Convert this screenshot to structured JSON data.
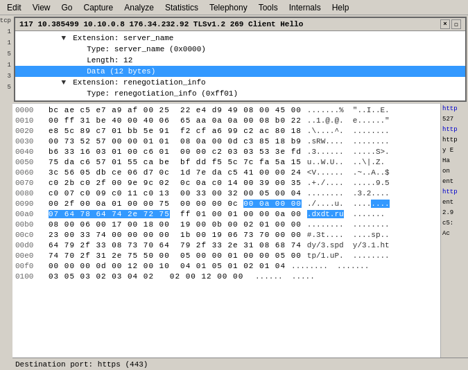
{
  "menu": {
    "items": [
      "Edit",
      "View",
      "Go",
      "Capture",
      "Analyze",
      "Statistics",
      "Telephony",
      "Tools",
      "Internals",
      "Help"
    ]
  },
  "panel": {
    "title": "117  10.385499  10.10.0.8  176.34.232.92  TLSv1.2  269  Client Hello",
    "close_label": "×",
    "resize_label": "◻"
  },
  "tree": {
    "rows": [
      {
        "indent": 60,
        "triangle": "",
        "text": "Extension: server_name",
        "selected": false
      },
      {
        "indent": 80,
        "triangle": "",
        "text": "Type: server_name (0x0000)",
        "selected": false
      },
      {
        "indent": 80,
        "triangle": "",
        "text": "Length: 12",
        "selected": false
      },
      {
        "indent": 80,
        "triangle": "",
        "text": "Data (12 bytes)",
        "selected": true
      },
      {
        "indent": 60,
        "triangle": "▼",
        "text": "Extension: renegotiation_info",
        "selected": false
      },
      {
        "indent": 80,
        "triangle": "",
        "text": "Type: renegotiation_info (0xff01)",
        "selected": false
      }
    ]
  },
  "hex": {
    "rows": [
      {
        "offset": "0000",
        "bytes": "bc ae c5 e7 a9 af 00 25  22 e4 d9 49 08 00 45 00",
        "ascii": ".......%  \"..I..E.",
        "highlight": null
      },
      {
        "offset": "0010",
        "bytes": "00 ff 31 be 40 00 40 06  65 aa 0a 0a 00 08 b0 22",
        "ascii": "..1.@.@.  e......\"",
        "highlight": null
      },
      {
        "offset": "0020",
        "bytes": "e8 5c 89 c7 01 bb 5e 91  f2 cf a6 99 c2 ac 80 18",
        "ascii": ".\\....^.  ........",
        "highlight": null
      },
      {
        "offset": "0030",
        "bytes": "00 73 52 57 00 00 01 01  08 0a 00 0d c3 85 18 b9",
        "ascii": ".sRW....  ........",
        "highlight": null
      },
      {
        "offset": "0040",
        "bytes": "b6 33 16 03 01 00 c6 01  00 00 c2 03 03 53 3e fd",
        "ascii": ".3.......  .....S>.",
        "highlight": null
      },
      {
        "offset": "0050",
        "bytes": "75 da c6 57 01 55 ca be  bf dd f5 5c 7c fa 5a 15",
        "ascii": "u..W.U..  ..\\|.Z.",
        "highlight": null
      },
      {
        "offset": "0060",
        "bytes": "3c 56 05 db ce 06 d7 0c  1d 7e da c5 41 00 00 24",
        "ascii": "<V......  .~..A..$",
        "highlight": null
      },
      {
        "offset": "0070",
        "bytes": "c0 2b c0 2f 00 9e 9c 02  0c 0a c0 14 00 39 00 35",
        "ascii": ".+./....  .....9.5",
        "highlight": null
      },
      {
        "offset": "0080",
        "bytes": "c0 07 c0 09 c0 11 c0 13  00 33 00 32 00 05 00 04",
        "ascii": "........  .3.2....",
        "highlight": null
      },
      {
        "offset": "0090",
        "bytes": "00 2f 00 0a 01 00 00 75  00 00 00 0c 00 0a 00 00",
        "ascii": "./....u.  ........",
        "highlight": "end"
      },
      {
        "offset": "00a0",
        "bytes": "07 64 78 64 74 2e 72 75  ff 01 00 01 00 00 0a 00",
        "ascii": ".dxdt.ru  ........",
        "highlight": "start"
      },
      {
        "offset": "00b0",
        "bytes": "08 00 06 00 17 00 18 00  19 00 0b 00 02 01 00 00",
        "ascii": "........  ........",
        "highlight": null
      },
      {
        "offset": "00c0",
        "bytes": "23 00 33 74 00 00 00 00  1b 00 19 06 73 70 00 00",
        "ascii": "#.3t....  ....sp..",
        "highlight": null
      },
      {
        "offset": "00d0",
        "bytes": "64 79 2f 33 08 73 70 64  79 2f 33 2e 31 08 68 74",
        "ascii": "dy/3.spd  y/3.1.ht",
        "highlight": null
      },
      {
        "offset": "00e0",
        "bytes": "74 70 2f 31 2e 75 50 00  05 00 00 01 00 00 05 00",
        "ascii": "tp/1.uP.  ........",
        "highlight": null
      },
      {
        "offset": "00f0",
        "bytes": "00 00 00 0d 00 12 00 10  04 01 05 01 02 01 04",
        "ascii": "..........  .....",
        "highlight": null
      },
      {
        "offset": "0100",
        "bytes": "03 05 03 02 03 04 02  02 00 12 00 00",
        "ascii": ".......  .....",
        "highlight": null
      }
    ]
  },
  "status": {
    "text": "Destination port: https (443)"
  },
  "right_labels": [
    "http",
    "527",
    "http",
    "http",
    "y E",
    "Ha",
    "on",
    "ent",
    "http",
    "ent",
    "2.9",
    "c5:",
    "Ac"
  ]
}
